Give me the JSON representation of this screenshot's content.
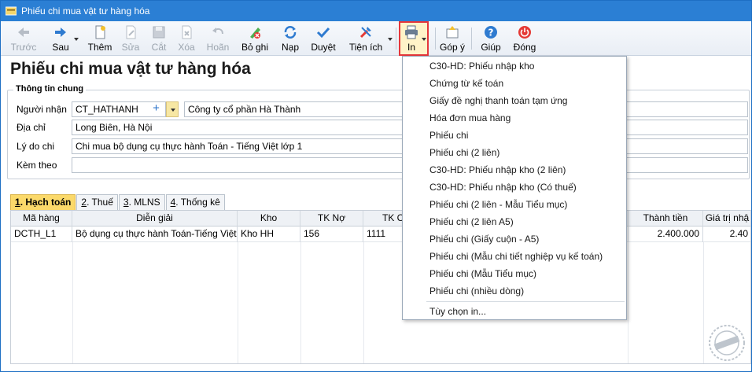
{
  "window": {
    "title": "Phiếu chi mua vật tư hàng hóa"
  },
  "toolbar": {
    "prev": "Trước",
    "next": "Sau",
    "add": "Thêm",
    "edit": "Sửa",
    "cut": "Cắt",
    "delete": "Xóa",
    "undo": "Hoãn",
    "unpost": "Bỏ ghi",
    "reload": "Nạp",
    "approve": "Duyệt",
    "utilities": "Tiện ích",
    "print": "In",
    "feedback": "Góp ý",
    "help": "Giúp",
    "close": "Đóng"
  },
  "form": {
    "title": "Phiếu chi mua vật tư hàng hóa",
    "group_title": "Thông tin chung",
    "recipient_label": "Người nhận",
    "recipient_code": "CT_HATHANH",
    "recipient_name": "Công ty cổ phần Hà Thành",
    "address_label": "Địa chỉ",
    "address": "Long Biên, Hà Nội",
    "reason_label": "Lý do chi",
    "reason": "Chi mua bộ dụng cụ thực hành Toán - Tiếng Việt lớp 1",
    "attach_label": "Kèm theo",
    "attach": ""
  },
  "tabs": [
    {
      "key": "1",
      "label": ". Hạch toán"
    },
    {
      "key": "2",
      "label": ". Thuế"
    },
    {
      "key": "3",
      "label": ". MLNS"
    },
    {
      "key": "4",
      "label": ". Thống kê"
    }
  ],
  "grid": {
    "headers": [
      "Mã hàng",
      "Diễn giải",
      "Kho",
      "TK Nợ",
      "TK C",
      "Thành tiền",
      "Giá trị nhậ"
    ],
    "rows": [
      {
        "code": "DCTH_L1",
        "desc": "Bộ dụng cụ thực hành Toán-Tiếng Việt...",
        "warehouse": "Kho HH",
        "debit": "156",
        "credit": "1111",
        "amount": "2.400.000",
        "value": "2.40"
      }
    ]
  },
  "print_menu": {
    "items": [
      "C30-HD: Phiếu nhập kho",
      "Chứng từ kế toán",
      "Giấy đề nghị thanh toán tạm ứng",
      "Hóa đơn mua hàng",
      "Phiếu chi",
      "Phiếu chi (2 liên)",
      "C30-HD: Phiếu nhập kho (2 liên)",
      "C30-HD: Phiếu nhập kho (Có thuế)",
      "Phiếu chi (2 liên - Mẫu Tiểu mục)",
      "Phiếu chi (2 liên A5)",
      "Phiếu chi (Giấy cuộn - A5)",
      "Phiếu chi (Mẫu chi tiết nghiệp vụ kế toán)",
      "Phiếu chi (Mẫu Tiểu mục)",
      "Phiếu chi (nhiều dòng)"
    ],
    "options": "Tùy chọn in..."
  },
  "colors": {
    "titlebar": "#2b7fd4",
    "active_tab": "#fbd96a",
    "highlight_border": "#e5373b"
  }
}
